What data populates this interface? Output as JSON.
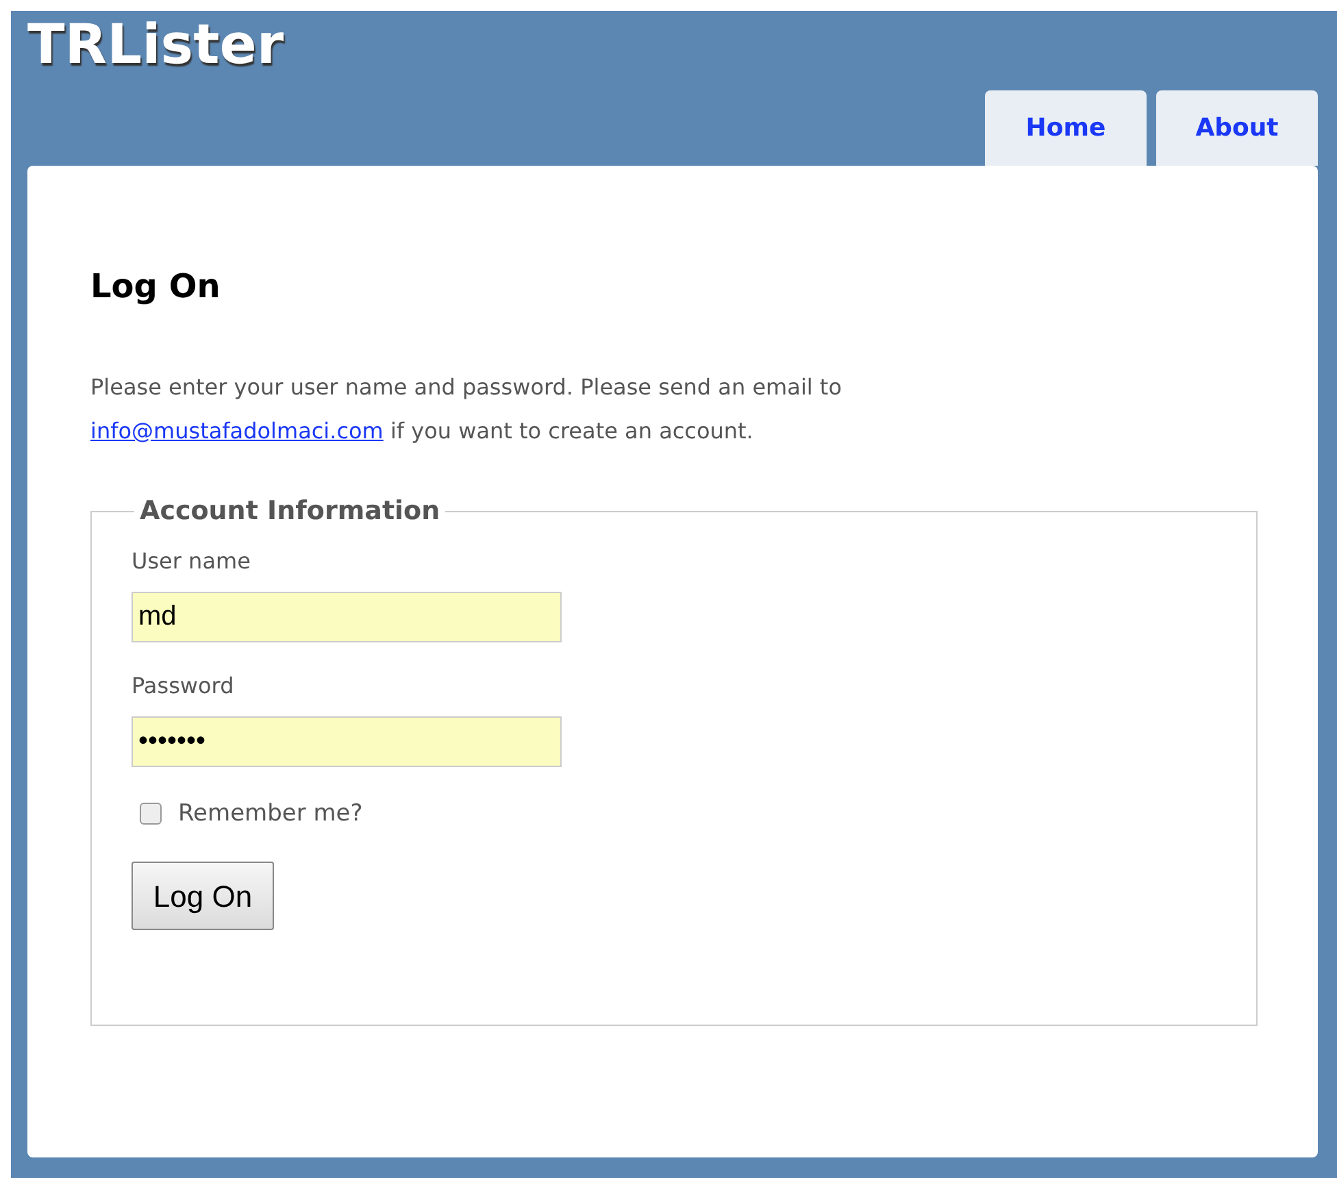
{
  "site_title": "TRLister",
  "nav": [
    {
      "label": "Home"
    },
    {
      "label": "About"
    }
  ],
  "heading": "Log On",
  "intro": {
    "before": "Please enter your user name and password. Please send an email to",
    "link": "info@mustafadolmaci.com",
    "after": "if you want to create an account."
  },
  "fieldset": {
    "legend": "Account Information",
    "fields": [
      {
        "label": "User name",
        "value": "md"
      },
      {
        "label": "Password",
        "value": "•••••••"
      }
    ],
    "remember": {
      "label": "Remember me?",
      "checked": false
    },
    "submit": "Log On"
  }
}
